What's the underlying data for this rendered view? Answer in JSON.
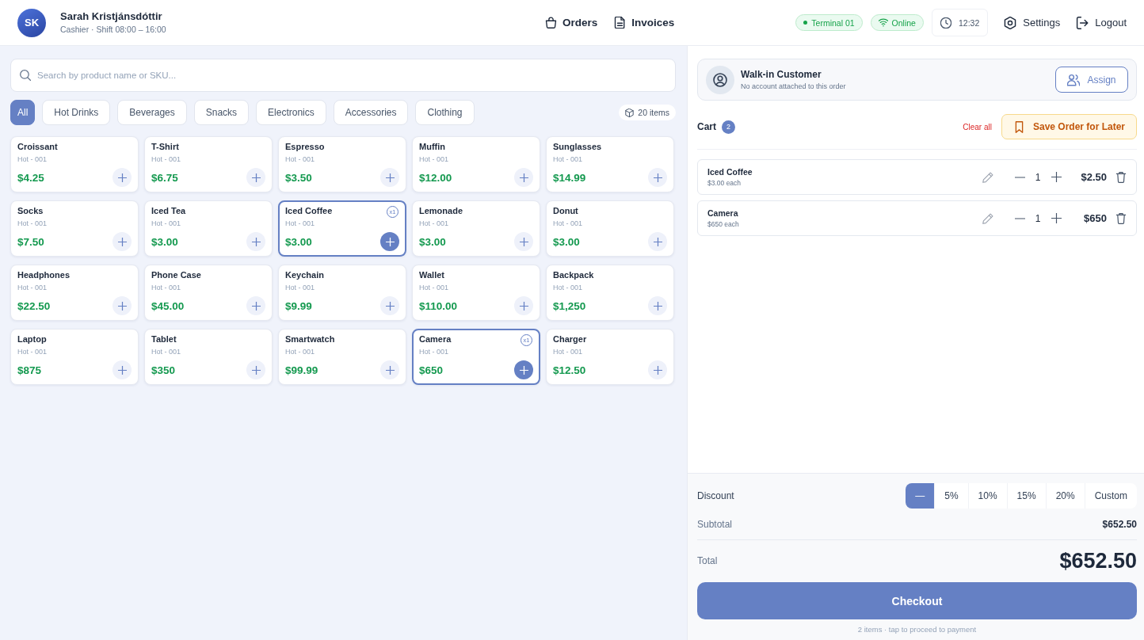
{
  "header": {
    "avatar_initials": "SK",
    "user_name": "Sarah Kristjánsdóttir",
    "user_role": "Cashier · Shift 08:00 – 16:00",
    "nav": [
      {
        "label": "Orders"
      },
      {
        "label": "Invoices"
      }
    ],
    "status_badges": [
      {
        "kind": "terminal",
        "label": "Terminal 01"
      },
      {
        "kind": "connection",
        "label": "Online"
      }
    ],
    "clock": "12:32",
    "actions": [
      {
        "label": "Settings"
      },
      {
        "label": "Logout"
      }
    ]
  },
  "catalog": {
    "search": {
      "placeholder": "Search by product name or SKU..."
    },
    "categories": [
      {
        "label": "All",
        "selected": true
      },
      {
        "label": "Hot Drinks",
        "selected": false
      },
      {
        "label": "Beverages",
        "selected": false
      },
      {
        "label": "Snacks",
        "selected": false
      },
      {
        "label": "Electronics",
        "selected": false
      },
      {
        "label": "Accessories",
        "selected": false
      },
      {
        "label": "Clothing",
        "selected": false
      }
    ],
    "item_count": "20 items",
    "products": [
      {
        "name": "Croissant",
        "sku": "Hot - 001",
        "price": "$4.25",
        "selected": false
      },
      {
        "name": "T-Shirt",
        "sku": "Hot - 001",
        "price": "$6.75",
        "selected": false
      },
      {
        "name": "Espresso",
        "sku": "Hot - 001",
        "price": "$3.50",
        "selected": false
      },
      {
        "name": "Muffin",
        "sku": "Hot - 001",
        "price": "$12.00",
        "selected": false
      },
      {
        "name": "Sunglasses",
        "sku": "Hot - 001",
        "price": "$14.99",
        "selected": false
      },
      {
        "name": "Socks",
        "sku": "Hot - 001",
        "price": "$7.50",
        "selected": false
      },
      {
        "name": "Iced Tea",
        "sku": "Hot - 001",
        "price": "$3.00",
        "selected": false
      },
      {
        "name": "Iced Coffee",
        "sku": "Hot - 001",
        "price": "$3.00",
        "selected": true,
        "quantity_badge": "x1"
      },
      {
        "name": "Lemonade",
        "sku": "Hot - 001",
        "price": "$3.00",
        "selected": false
      },
      {
        "name": "Donut",
        "sku": "Hot - 001",
        "price": "$3.00",
        "selected": false
      },
      {
        "name": "Headphones",
        "sku": "Hot - 001",
        "price": "$22.50",
        "selected": false
      },
      {
        "name": "Phone Case",
        "sku": "Hot - 001",
        "price": "$45.00",
        "selected": false
      },
      {
        "name": "Keychain",
        "sku": "Hot - 001",
        "price": "$9.99",
        "selected": false
      },
      {
        "name": "Wallet",
        "sku": "Hot - 001",
        "price": "$110.00",
        "selected": false
      },
      {
        "name": "Backpack",
        "sku": "Hot - 001",
        "price": "$1,250",
        "selected": false
      },
      {
        "name": "Laptop",
        "sku": "Hot - 001",
        "price": "$875",
        "selected": false
      },
      {
        "name": "Tablet",
        "sku": "Hot - 001",
        "price": "$350",
        "selected": false
      },
      {
        "name": "Smartwatch",
        "sku": "Hot - 001",
        "price": "$99.99",
        "selected": false
      },
      {
        "name": "Camera",
        "sku": "Hot - 001",
        "price": "$650",
        "selected": true,
        "quantity_badge": "x1"
      },
      {
        "name": "Charger",
        "sku": "Hot - 001",
        "price": "$12.50",
        "selected": false
      }
    ]
  },
  "order": {
    "customer": {
      "name": "Walk-in Customer",
      "note": "No account attached to this order",
      "assign_label": "Assign"
    },
    "cart": {
      "title": "Cart",
      "count": "2",
      "clear_label": "Clear all",
      "save_label": "Save Order for Later",
      "items": [
        {
          "name": "Iced Coffee",
          "unit_price": "$3.00 each",
          "quantity": "1",
          "line_total": "$2.50"
        },
        {
          "name": "Camera",
          "unit_price": "$650 each",
          "quantity": "1",
          "line_total": "$650"
        }
      ]
    }
  },
  "summary": {
    "discount": {
      "label": "Discount",
      "options": [
        {
          "label": "—",
          "selected": true
        },
        {
          "label": "5%",
          "selected": false
        },
        {
          "label": "10%",
          "selected": false
        },
        {
          "label": "15%",
          "selected": false
        },
        {
          "label": "20%",
          "selected": false
        },
        {
          "label": "Custom",
          "selected": false
        }
      ]
    },
    "subtotal": {
      "label": "Subtotal",
      "value": "$652.50"
    },
    "total": {
      "label": "Total",
      "value": "$652.50"
    },
    "checkout": {
      "label": "Checkout",
      "hint": "2 items · tap to proceed to payment"
    }
  }
}
